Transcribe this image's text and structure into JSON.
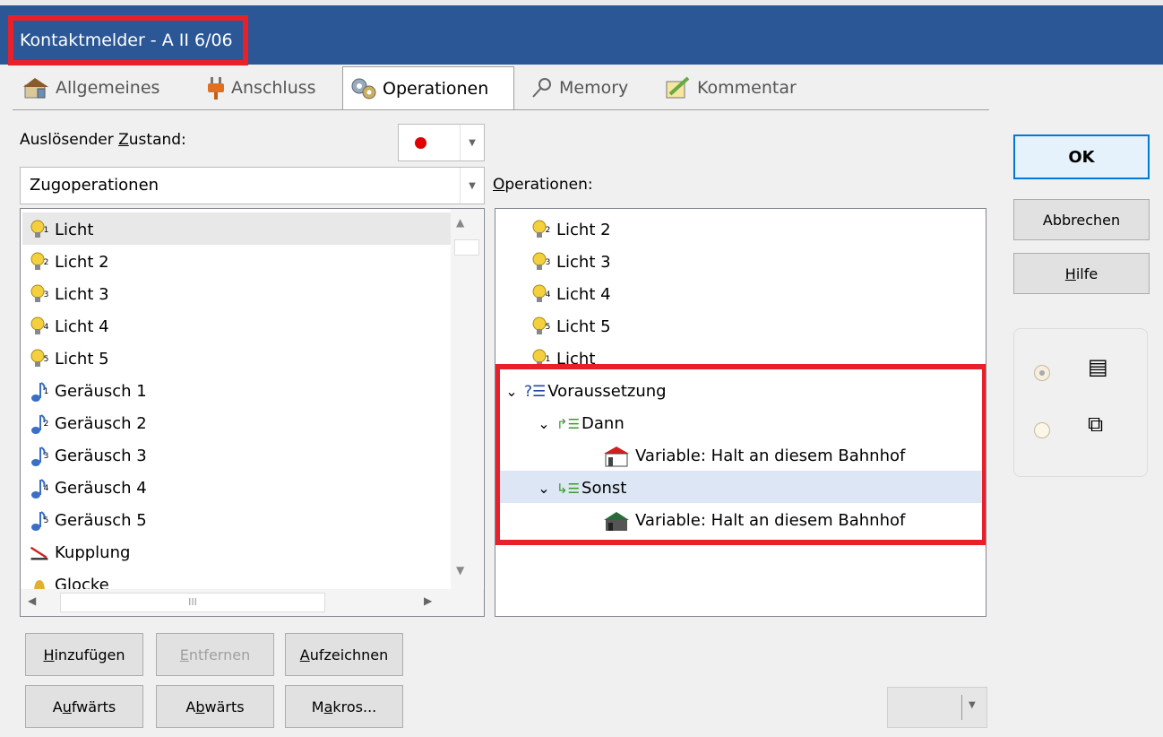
{
  "window": {
    "title": "Kontaktmelder - A II 6/06"
  },
  "tabs": [
    {
      "label": "Allgemeines"
    },
    {
      "label": "Anschluss"
    },
    {
      "label": "Operationen"
    },
    {
      "label": "Memory"
    },
    {
      "label": "Kommentar"
    }
  ],
  "trigger": {
    "label_pre": "Auslösender ",
    "label_u": "Z",
    "label_post": "ustand:",
    "color": "#e00000"
  },
  "category": {
    "value": "Zugoperationen"
  },
  "left_list": {
    "items": [
      {
        "label": "Licht",
        "icon": "bulb-icon",
        "sub": "1"
      },
      {
        "label": "Licht 2",
        "icon": "bulb-icon",
        "sub": "2"
      },
      {
        "label": "Licht 3",
        "icon": "bulb-icon",
        "sub": "3"
      },
      {
        "label": "Licht 4",
        "icon": "bulb-icon",
        "sub": "4"
      },
      {
        "label": "Licht 5",
        "icon": "bulb-icon",
        "sub": "5"
      },
      {
        "label": "Geräusch 1",
        "icon": "note-icon",
        "sub": "1"
      },
      {
        "label": "Geräusch 2",
        "icon": "note-icon",
        "sub": "2"
      },
      {
        "label": "Geräusch 3",
        "icon": "note-icon",
        "sub": "3"
      },
      {
        "label": "Geräusch 4",
        "icon": "note-icon",
        "sub": "4"
      },
      {
        "label": "Geräusch 5",
        "icon": "note-icon",
        "sub": "5"
      },
      {
        "label": "Kupplung",
        "icon": "coupling-icon",
        "sub": ""
      },
      {
        "label": "Glocke",
        "icon": "bell-icon",
        "sub": ""
      }
    ],
    "hscroll_grip": "III"
  },
  "operations": {
    "label_u": "O",
    "label_post": "perationen:",
    "items": [
      {
        "label": "Licht 2",
        "sub": "2"
      },
      {
        "label": "Licht 3",
        "sub": "3"
      },
      {
        "label": "Licht 4",
        "sub": "4"
      },
      {
        "label": "Licht 5",
        "sub": "5"
      },
      {
        "label": "Licht",
        "sub": "1"
      }
    ],
    "tree": {
      "condition": "Voraussetzung",
      "then": "Dann",
      "then_child": "Variable: Halt an diesem Bahnhof",
      "else": "Sonst",
      "else_child": "Variable: Halt an diesem Bahnhof"
    }
  },
  "buttons": {
    "ok": "OK",
    "cancel": "Abbrechen",
    "help_u": "H",
    "help_post": "ilfe",
    "add_u": "H",
    "add_post": "inzufügen",
    "remove_u": "E",
    "remove_post": "ntfernen",
    "record_u": "A",
    "record_post": "ufzeichnen",
    "up_pre": "A",
    "up_u": "u",
    "up_post": "fwärts",
    "down_pre": "A",
    "down_u": "b",
    "down_post": "wärts",
    "macros_pre": "M",
    "macros_u": "a",
    "macros_post": "kros..."
  },
  "accent": "#2b5797",
  "highlight": "#e8202a"
}
